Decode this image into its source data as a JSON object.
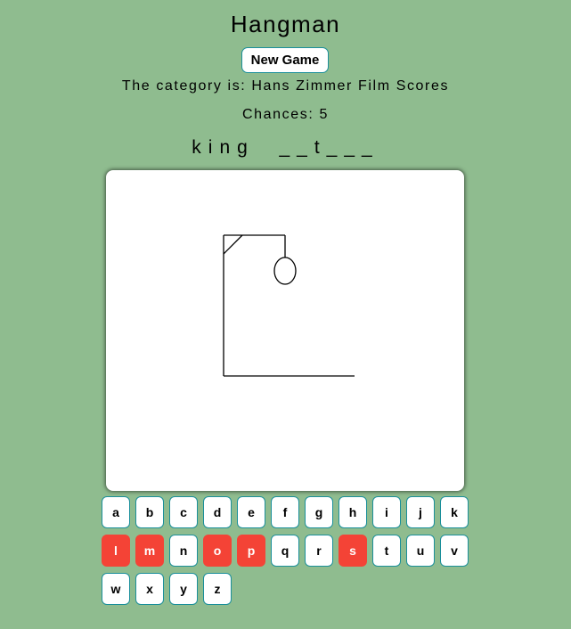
{
  "title": "Hangman",
  "new_game_label": "New Game",
  "category_text": "The category is: Hans Zimmer Film Scores",
  "chances_text": "Chances: 5",
  "word_display": "king  __t___",
  "colors": {
    "background": "#8fbc8f",
    "key_border": "#1a8f9a",
    "wrong_key": "#f44336"
  },
  "hangman": {
    "drawn_parts": [
      "base",
      "pole",
      "beam",
      "brace",
      "rope",
      "head"
    ]
  },
  "keyboard": {
    "rows": [
      [
        {
          "letter": "a",
          "state": "unused"
        },
        {
          "letter": "b",
          "state": "unused"
        },
        {
          "letter": "c",
          "state": "unused"
        },
        {
          "letter": "d",
          "state": "unused"
        },
        {
          "letter": "e",
          "state": "unused"
        },
        {
          "letter": "f",
          "state": "unused"
        },
        {
          "letter": "g",
          "state": "unused"
        },
        {
          "letter": "h",
          "state": "unused"
        },
        {
          "letter": "i",
          "state": "unused"
        },
        {
          "letter": "j",
          "state": "unused"
        },
        {
          "letter": "k",
          "state": "unused"
        }
      ],
      [
        {
          "letter": "l",
          "state": "wrong"
        },
        {
          "letter": "m",
          "state": "wrong"
        },
        {
          "letter": "n",
          "state": "unused"
        },
        {
          "letter": "o",
          "state": "wrong"
        },
        {
          "letter": "p",
          "state": "wrong"
        },
        {
          "letter": "q",
          "state": "unused"
        },
        {
          "letter": "r",
          "state": "unused"
        },
        {
          "letter": "s",
          "state": "wrong"
        },
        {
          "letter": "t",
          "state": "unused"
        },
        {
          "letter": "u",
          "state": "unused"
        },
        {
          "letter": "v",
          "state": "unused"
        }
      ],
      [
        {
          "letter": "w",
          "state": "unused"
        },
        {
          "letter": "x",
          "state": "unused"
        },
        {
          "letter": "y",
          "state": "unused"
        },
        {
          "letter": "z",
          "state": "unused"
        }
      ]
    ]
  }
}
